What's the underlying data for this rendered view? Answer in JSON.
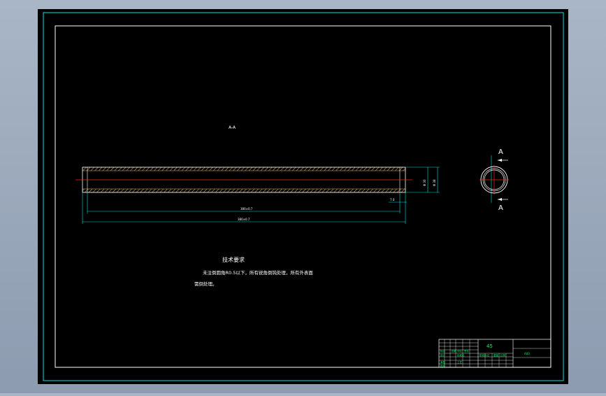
{
  "drawing": {
    "section_label": "A-A",
    "view_label_a_top": "A",
    "view_label_a_bottom": "A",
    "dim_inner_length": "380±0.7",
    "dim_overall_length": "380±0.7",
    "dim_end_small": "7.0",
    "dim_dia_outer": "Φ 38",
    "dim_dia_inner": "Φ 30",
    "tech_title": "技术要求",
    "tech_line1": "未注倒圆角R0.5以下，所有锐角倒钝处理，所有外表面",
    "tech_line2": "需倒处理。"
  },
  "title_block": {
    "material": "45",
    "drawing_number": "A00",
    "drawing_name": "",
    "cells": [
      "标记",
      "处数",
      "分区",
      "更改文件号",
      "签名",
      "年月日",
      "设计",
      "标准化",
      "阶段标记",
      "重量",
      "比例",
      "审核",
      "工艺",
      "批准"
    ]
  },
  "colors": {
    "canvas": "#000000",
    "border": "#00e5e5",
    "frame": "#ffffff",
    "centerline": "#ff2020",
    "dimension": "#00e0e0",
    "text": "#ffffff",
    "title_green": "#00ff60",
    "hatch": "#c8a060"
  }
}
